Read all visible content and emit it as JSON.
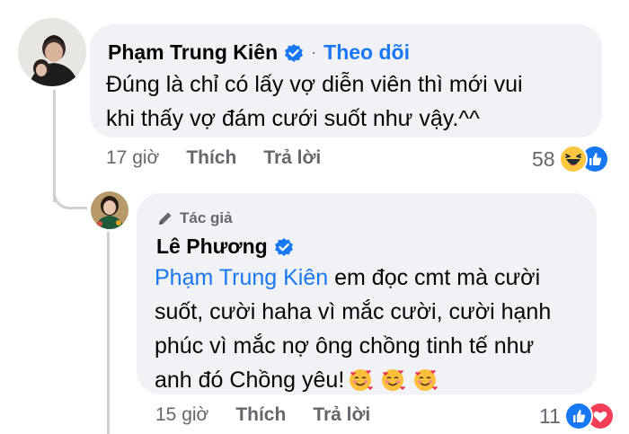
{
  "comment": {
    "author": "Phạm Trung Kiên",
    "follow_label": "Theo dõi",
    "separator": "·",
    "text_line1": "Đúng là chỉ có lấy vợ diễn viên thì mới vui",
    "text_line2": "khi thấy vợ đám cưới suốt như vậy.^^",
    "time": "17 giờ",
    "like_label": "Thích",
    "reply_label": "Trả lời",
    "reaction_count": "58",
    "reactions": [
      "haha-icon",
      "like-icon"
    ]
  },
  "reply": {
    "author_tag": "Tác giả",
    "author": "Lê Phương",
    "mention": "Phạm Trung Kiên",
    "text_line1_rest": " em đọc cmt mà cười",
    "text_line2": "suốt, cười haha vì mắc cười, cười hạnh",
    "text_line3": "phúc vì mắc nợ ông chồng tinh tế như",
    "text_line4": "anh đó Chồng yêu!",
    "emojis": [
      "smiling-face-with-hearts",
      "smiling-face-with-hearts",
      "smiling-face-with-hearts"
    ],
    "time": "15 giờ",
    "like_label": "Thích",
    "reply_label": "Trả lời",
    "reaction_count": "11",
    "reactions": [
      "like-icon",
      "love-icon"
    ]
  },
  "colors": {
    "bubble": "#f0f2f5",
    "link_blue": "#1877f2",
    "meta_gray": "#65676b",
    "thread_line": "#ced0d4"
  }
}
